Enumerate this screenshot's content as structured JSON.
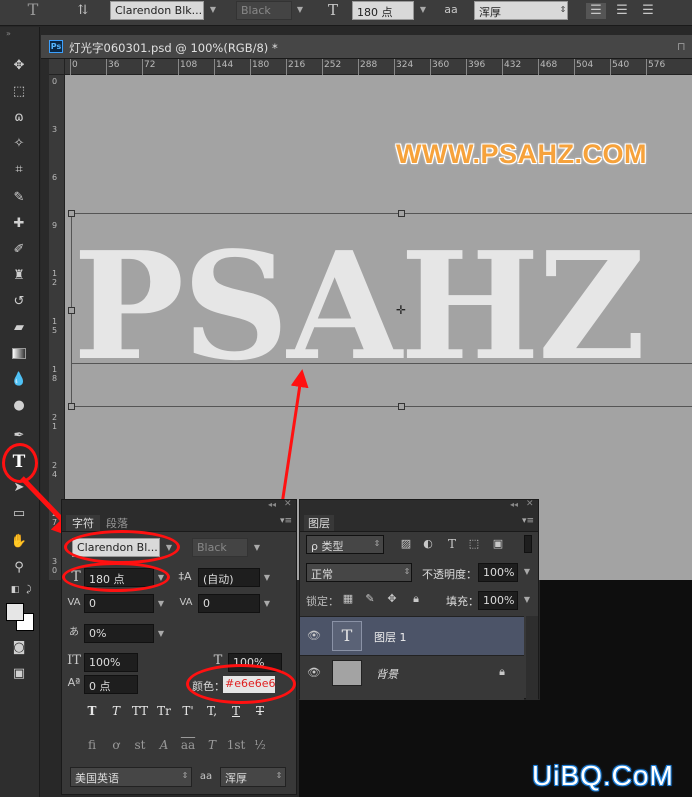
{
  "options_bar": {
    "font_family": "Clarendon Blk...",
    "font_style": "Black",
    "font_size": "180 点",
    "antialias_label": "aa",
    "antialias": "浑厚"
  },
  "document": {
    "tab_title": "灯光字060301.psd @ 100%(RGB/8) *",
    "ps_badge": "Ps",
    "ruler_ticks": [
      "0",
      "36",
      "72",
      "108",
      "144",
      "180",
      "216",
      "252",
      "288",
      "324",
      "360",
      "396",
      "432",
      "468",
      "504",
      "540",
      "576"
    ],
    "vertical_ruler": [
      "0",
      "3",
      "6",
      "9",
      "1 2",
      "1 5",
      "1 8",
      "2 1",
      "2 4",
      "2 7",
      "3 0"
    ],
    "watermark": "WWW.PSAHZ.COM",
    "canvas_text": "PSAHZ"
  },
  "character_panel": {
    "tab_character": "字符",
    "tab_paragraph": "段落",
    "font_family": "Clarendon Bl...",
    "font_style": "Black",
    "font_size": "180 点",
    "leading": "(自动)",
    "kerning": "0",
    "tracking": "0",
    "tsume": "0%",
    "vertical_scale": "100%",
    "horizontal_scale": "100%",
    "baseline_shift": "0 点",
    "color_label": "颜色：",
    "color_value": "#e6e6e6",
    "style_buttons": [
      "T",
      "T",
      "TT",
      "Tr",
      "T'",
      "T,",
      "T",
      "T"
    ],
    "opentype_buttons": [
      "fi",
      "ơ",
      "st",
      "A",
      "aa",
      "T",
      "1st",
      "½"
    ],
    "language": "美国英语",
    "antialias_label": "aa",
    "antialias": "浑厚"
  },
  "layers_panel": {
    "tab": "图层",
    "filter_kind": "ρ 类型",
    "blend_mode": "正常",
    "opacity_label": "不透明度：",
    "opacity": "100%",
    "lock_label": "锁定：",
    "fill_label": "填充：",
    "fill": "100%",
    "layers": [
      {
        "name": "图层 1",
        "thumb": "T"
      },
      {
        "name": "背景",
        "thumb": ""
      }
    ]
  },
  "site_watermark": "UiBQ.CoM",
  "colors": {
    "canvas_bg": "#a3a3a3",
    "text_fill": "#e6e6e6",
    "watermark_fill": "#f6a23b",
    "annotation": "#ff1111",
    "ui_dark": "#282828",
    "panel": "#383838"
  }
}
